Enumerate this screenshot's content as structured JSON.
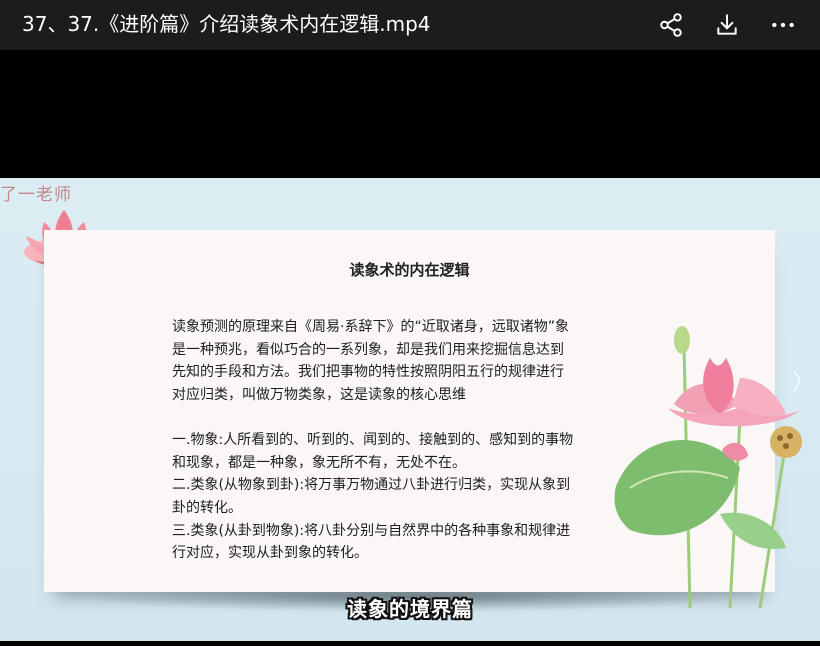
{
  "header": {
    "title": "37、37.《进阶篇》介绍读象术内在逻辑.mp4",
    "icons": [
      "share-icon",
      "download-icon",
      "more-icon"
    ]
  },
  "slide": {
    "watermark": "了一老师",
    "title": "读象术的内在逻辑",
    "intro": [
      "读象预测的原理来自《周易·系辞下》的“近取诸身，远取诸物”象",
      "是一种预兆，看似巧合的一系列象，却是我们用来挖掘信息达到",
      "先知的手段和方法。我们把事物的特性按照阴阳五行的规律进行",
      "对应归类，叫做万物类象，这是读象的核心思维"
    ],
    "points": [
      "一.物象:人所看到的、听到的、闻到的、接触到的、感知到的事物",
      "和现象，都是一种象，象无所不有，无处不在。",
      "二.类象(从物象到卦):将万事万物通过八卦进行归类，实现从象到",
      "卦的转化。",
      "三.类象(从卦到物象):将八卦分别与自然界中的各种事象和规律进",
      "行对应，实现从卦到象的转化。"
    ],
    "subtitle": "读象的境界篇",
    "next_arrow": "〉"
  },
  "colors": {
    "topbar_bg": "#1c1c1c",
    "slide_bg": "#dcecf3",
    "card_bg": "#faf7f6",
    "lotus_pink": "#ef8a98",
    "leaf_green": "#8cc47a"
  }
}
